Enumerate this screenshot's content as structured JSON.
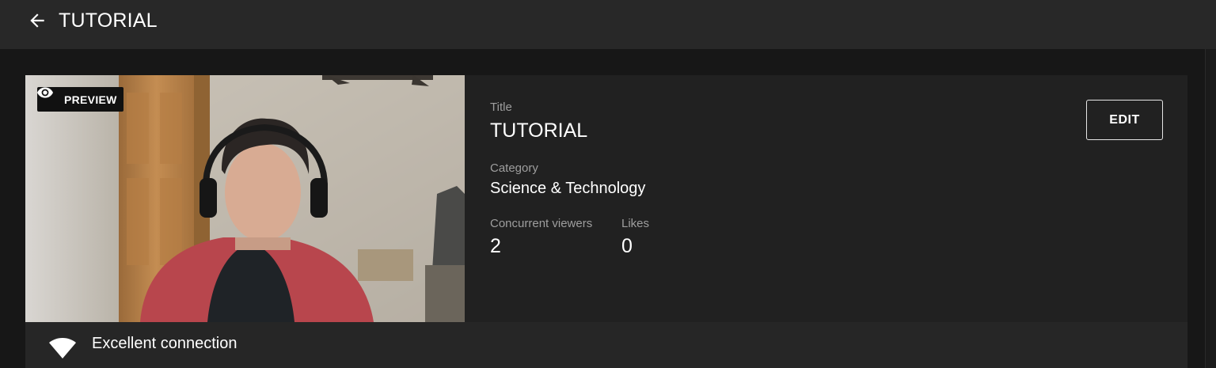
{
  "header": {
    "back_icon": "arrow-left-icon",
    "title": "TUTORIAL"
  },
  "preview": {
    "badge_icon": "eye-icon",
    "badge_label": "PREVIEW"
  },
  "details": {
    "title_label": "Title",
    "title_value": "TUTORIAL",
    "category_label": "Category",
    "category_value": "Science & Technology",
    "stats": [
      {
        "label": "Concurrent viewers",
        "value": "2"
      },
      {
        "label": "Likes",
        "value": "0"
      }
    ],
    "edit_label": "EDIT"
  },
  "connection": {
    "icon": "wifi-icon",
    "status": "Excellent connection"
  },
  "colors": {
    "topbar_bg": "#282828",
    "page_bg": "#171717",
    "card_bg": "#212121",
    "status_bg": "#262626",
    "label_text": "#9e9e9e"
  }
}
